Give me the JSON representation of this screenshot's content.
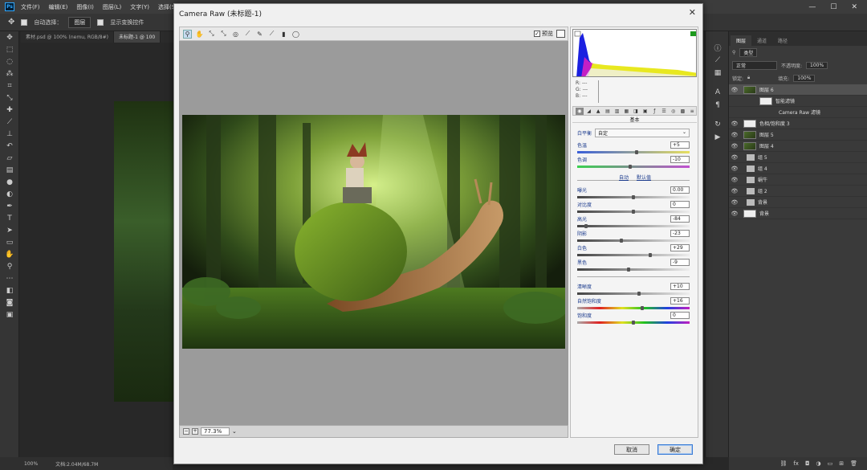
{
  "menubar": {
    "logo": "Ps",
    "items": [
      "文件(F)",
      "编辑(E)",
      "图像(I)",
      "图层(L)",
      "文字(Y)",
      "选择(S)"
    ],
    "window_controls": [
      "—",
      "☐",
      "✕"
    ]
  },
  "optionsbar": {
    "auto_select_label": "自动选择：",
    "auto_select_value": "图层",
    "transform_label": "显示变换控件"
  },
  "doc_tabs": [
    "素材.psd @ 100% (nemu, RGB/8#)",
    "未标题-1 @ 100"
  ],
  "statusbar": {
    "zoom": "100%",
    "doc": "文档:2.04M/68.7M"
  },
  "dialog": {
    "title": "Camera Raw (未标题-1)",
    "preview_label": "预览",
    "zoom_value": "77.3%",
    "cancel_label": "取消",
    "ok_label": "确定",
    "rgb_labels": [
      "R:",
      "G:",
      "B:"
    ],
    "rgb_values": [
      "---",
      "---",
      "---"
    ],
    "section_title": "基本",
    "white_balance_label": "白平衡",
    "white_balance_value": "自定",
    "auto_link": "自动",
    "default_link": "默认值",
    "sliders": [
      {
        "label": "色温",
        "value": "+5",
        "pos": 0.53,
        "track": "temp"
      },
      {
        "label": "色调",
        "value": "-10",
        "pos": 0.47,
        "track": "tint"
      },
      {
        "label": "曝光",
        "value": "0.00",
        "pos": 0.5,
        "track": "gray"
      },
      {
        "label": "对比度",
        "value": "0",
        "pos": 0.5,
        "track": "gray"
      },
      {
        "label": "高光",
        "value": "-84",
        "pos": 0.08,
        "track": "gray"
      },
      {
        "label": "阴影",
        "value": "-23",
        "pos": 0.39,
        "track": "gray"
      },
      {
        "label": "白色",
        "value": "+29",
        "pos": 0.65,
        "track": "gray"
      },
      {
        "label": "黑色",
        "value": "-9",
        "pos": 0.46,
        "track": "gray"
      },
      {
        "label": "清晰度",
        "value": "+10",
        "pos": 0.55,
        "track": "gray"
      },
      {
        "label": "自然饱和度",
        "value": "+16",
        "pos": 0.58,
        "track": "sat"
      },
      {
        "label": "饱和度",
        "value": "0",
        "pos": 0.5,
        "track": "sat"
      }
    ]
  },
  "layers_panel": {
    "tabs": [
      "图层",
      "通道",
      "路径"
    ],
    "kind_label": "类型",
    "blend_mode": "正常",
    "opacity_label": "不透明度:",
    "opacity_value": "100%",
    "lock_label": "锁定:",
    "fill_label": "填充:",
    "fill_value": "100%",
    "layers": [
      {
        "name": "图层 6",
        "type": "pic",
        "selected": true
      },
      {
        "name": "智能滤镜",
        "type": "filter",
        "selected": false
      },
      {
        "name": "Camera Raw 滤镜",
        "type": "subfilter",
        "selected": false
      },
      {
        "name": "色相/饱和度 3",
        "type": "adj",
        "selected": false
      },
      {
        "name": "图层 5",
        "type": "pic",
        "selected": false
      },
      {
        "name": "图层 4",
        "type": "pic",
        "selected": false
      },
      {
        "name": "组 5",
        "type": "folder",
        "selected": false
      },
      {
        "name": "组 4",
        "type": "folder",
        "selected": false
      },
      {
        "name": "蜗牛",
        "type": "folder",
        "selected": false
      },
      {
        "name": "组 2",
        "type": "folder",
        "selected": false
      },
      {
        "name": "背景",
        "type": "folder",
        "selected": false
      },
      {
        "name": "背景",
        "type": "bg",
        "selected": false
      }
    ]
  }
}
